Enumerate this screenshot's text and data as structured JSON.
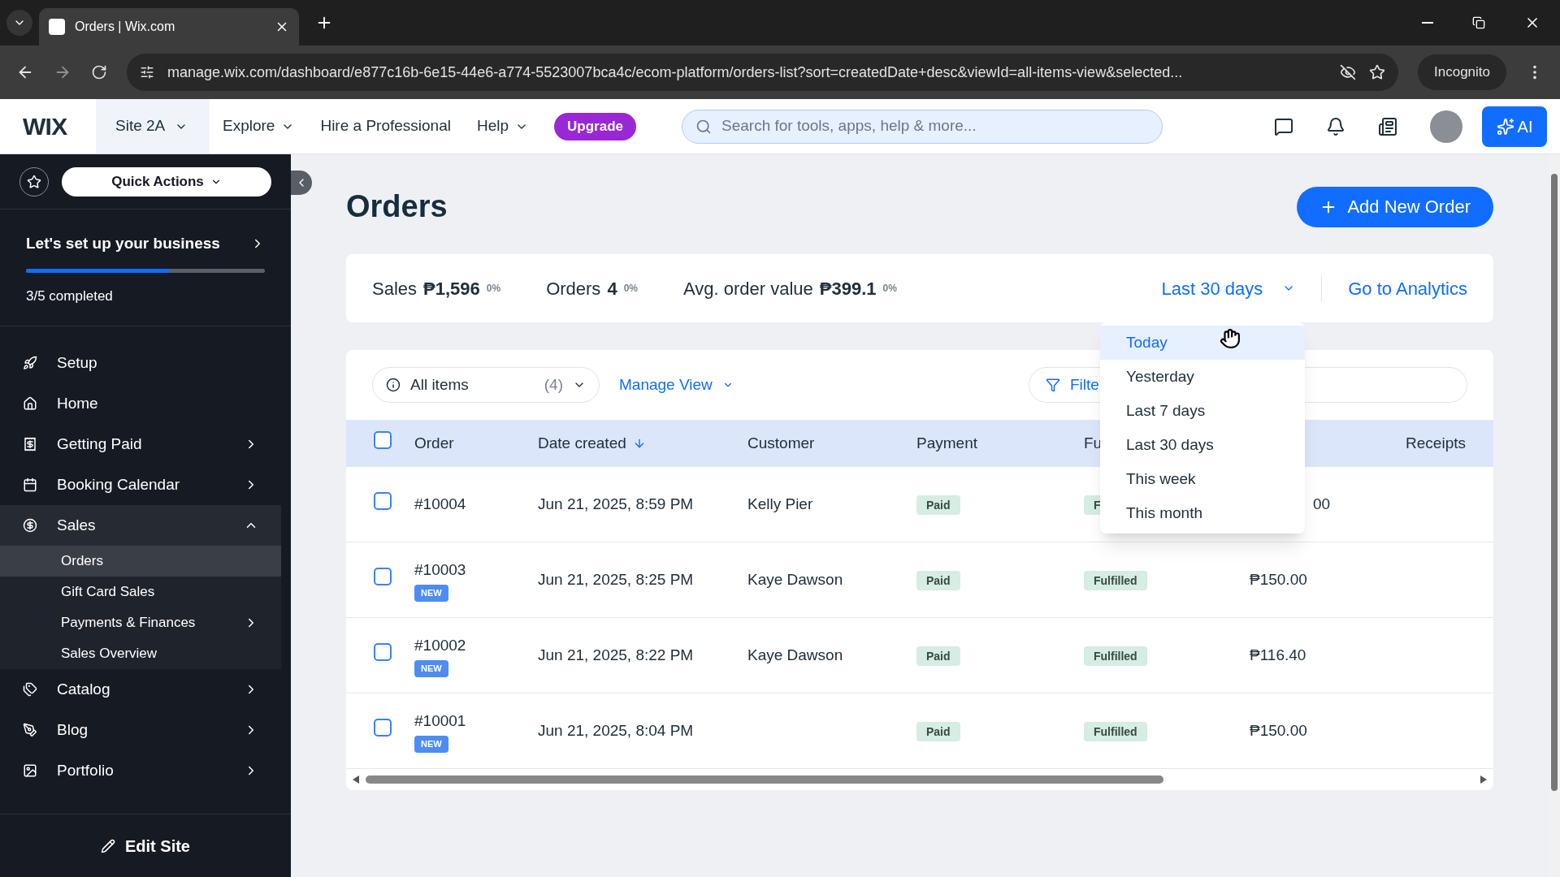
{
  "browser": {
    "tab_title": "Orders | Wix.com",
    "url": "manage.wix.com/dashboard/e877c16b-6e15-44e6-a774-5523007bca4c/ecom-platform/orders-list?sort=createdDate+desc&viewId=all-items-view&selected...",
    "incognito": "Incognito"
  },
  "header": {
    "logo": "WIX",
    "site": "Site 2A",
    "nav": [
      "Explore",
      "Hire a Professional",
      "Help"
    ],
    "upgrade": "Upgrade",
    "search_placeholder": "Search for tools, apps, help & more...",
    "ai": "AI"
  },
  "sidebar": {
    "quick_actions": "Quick Actions",
    "setup_title": "Let's set up your business",
    "setup_progress": "3/5 completed",
    "level": 0.6,
    "items": [
      {
        "label": "Setup",
        "chevron": false,
        "expanded": false
      },
      {
        "label": "Home",
        "chevron": false,
        "expanded": false
      },
      {
        "label": "Getting Paid",
        "chevron": true,
        "expanded": false
      },
      {
        "label": "Booking Calendar",
        "chevron": true,
        "expanded": false
      },
      {
        "label": "Sales",
        "chevron": true,
        "expanded": true,
        "children": [
          {
            "label": "Orders",
            "selected": true,
            "chevron": false
          },
          {
            "label": "Gift Card Sales",
            "selected": false,
            "chevron": false
          },
          {
            "label": "Payments & Finances",
            "selected": false,
            "chevron": true
          },
          {
            "label": "Sales Overview",
            "selected": false,
            "chevron": false
          }
        ]
      },
      {
        "label": "Catalog",
        "chevron": true,
        "expanded": false
      },
      {
        "label": "Blog",
        "chevron": true,
        "expanded": false
      },
      {
        "label": "Portfolio",
        "chevron": true,
        "expanded": false
      }
    ],
    "edit_site": "Edit Site"
  },
  "page": {
    "title": "Orders",
    "add_button": "Add New Order"
  },
  "stats": [
    {
      "label": "Sales",
      "value": "₱1,596",
      "change": "0%"
    },
    {
      "label": "Orders",
      "value": "4",
      "change": "0%"
    },
    {
      "label": "Avg. order value",
      "value": "₱399.1",
      "change": "0%"
    }
  ],
  "period": "Last 30 days",
  "analytics_link": "Go to Analytics",
  "period_menu": [
    {
      "label": "Today",
      "selected": true
    },
    {
      "label": "Yesterday",
      "selected": false
    },
    {
      "label": "Last 7 days",
      "selected": false
    },
    {
      "label": "Last 30 days",
      "selected": false
    },
    {
      "label": "This week",
      "selected": false
    },
    {
      "label": "This month",
      "selected": false
    }
  ],
  "toolbar": {
    "view": "All items",
    "count": "(4)",
    "manage_view": "Manage View",
    "filter": "Filte"
  },
  "table": {
    "all_checked": false,
    "columns": [
      "Order",
      "Date created",
      "Customer",
      "Payment",
      "Fu",
      "Receipts"
    ],
    "rows": [
      {
        "order": "#10004",
        "date": "Jun 21, 2025, 8:59 PM",
        "customer": "Kelly Pier",
        "payment": "Paid",
        "fulfillment": "F",
        "total": "00",
        "checked": false
      },
      {
        "order": "#10003",
        "badge": "NEW",
        "date": "Jun 21, 2025, 8:25 PM",
        "customer": "Kaye Dawson",
        "payment": "Paid",
        "fulfillment": "Fulfilled",
        "total": "₱150.00",
        "checked": false
      },
      {
        "order": "#10002",
        "badge": "NEW",
        "date": "Jun 21, 2025, 8:22 PM",
        "customer": "Kaye Dawson",
        "payment": "Paid",
        "fulfillment": "Fulfilled",
        "total": "₱116.40",
        "checked": false
      },
      {
        "order": "#10001",
        "badge": "NEW",
        "date": "Jun 21, 2025, 8:04 PM",
        "payment": "Paid",
        "fulfillment": "Fulfilled",
        "total": "₱150.00",
        "checked": false
      }
    ]
  }
}
